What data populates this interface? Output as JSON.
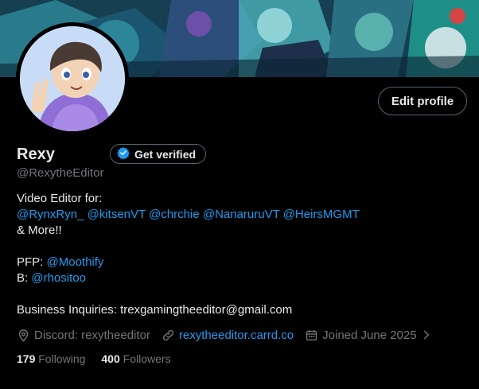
{
  "profile": {
    "name": "Rexy",
    "handle": "@RexytheEditor",
    "edit_label": "Edit profile",
    "verify_label": "Get verified"
  },
  "bio": {
    "line1": "Video Editor for:",
    "mentions": [
      "@RynxRyn_",
      "@kitsenVT",
      "@chrchie",
      "@NanaruruVT",
      "@HeirsMGMT"
    ],
    "line3": "& More!!",
    "pfp_label": "PFP:",
    "pfp_handle": "@Moothify",
    "b_label": "B:",
    "b_handle": "@rhositoo",
    "business": "Business Inquiries: trexgamingtheeditor@gmail.com"
  },
  "meta": {
    "location": "Discord: rexytheeditor",
    "website": "rexytheeditor.carrd.co",
    "joined": "Joined June 2025"
  },
  "stats": {
    "following_count": "179",
    "following_label": "Following",
    "followers_count": "400",
    "followers_label": "Followers"
  },
  "colors": {
    "accent": "#1d9bf0",
    "muted": "#71767b",
    "text": "#e7e9ea",
    "background": "#000000"
  },
  "icons": {
    "verify": "verified-badge-icon",
    "location": "location-pin-icon",
    "website": "link-icon",
    "joined": "calendar-icon",
    "more": "chevron-right-icon"
  }
}
